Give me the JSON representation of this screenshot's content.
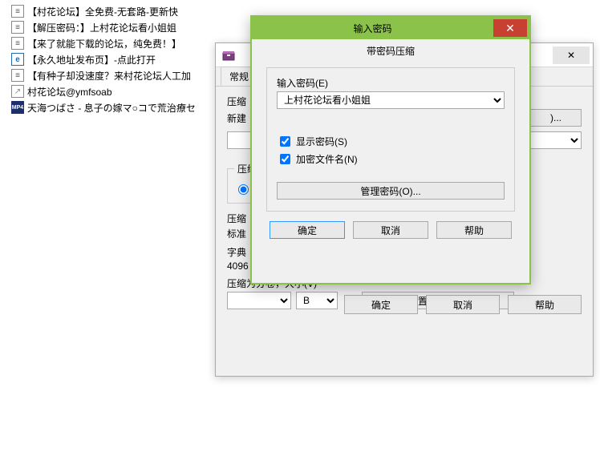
{
  "files": {
    "items": [
      {
        "icon": "text",
        "label": "【村花论坛】全免费-无套路-更新快"
      },
      {
        "icon": "text",
        "label": "【解压密码：】上村花论坛看小姐姐"
      },
      {
        "icon": "text",
        "label": "【来了就能下载的论坛，纯免费！】"
      },
      {
        "icon": "ie",
        "label": "【永久地址发布页】-点此打开"
      },
      {
        "icon": "text",
        "label": "【有种子却没速度？来村花论坛人工加"
      },
      {
        "icon": "url",
        "label": "村花论坛@ymfsoab"
      },
      {
        "icon": "mp4",
        "label": "天海つばさ - 息子の嫁マ○コで荒治療セ"
      }
    ]
  },
  "rar": {
    "tabs": {
      "general": "常规"
    },
    "archive_name_label": "压缩",
    "browse_label": ")...",
    "update_mode_label": "新建",
    "format_legend": "压缩",
    "format_rar": "⦿",
    "method_label": "压缩",
    "method_value": "标准",
    "dict_label": "字典",
    "dict_value": "4096",
    "split_label": "压缩为分卷，大小(V)",
    "split_unit": "B",
    "set_password": "设置密码(P)...",
    "ok": "确定",
    "cancel": "取消",
    "help": "帮助"
  },
  "pwd": {
    "title": "输入密码",
    "subtitle": "带密码压缩",
    "enter_label": "输入密码(E)",
    "value": "上村花论坛看小姐姐",
    "show": "显示密码(S)",
    "encrypt_names": "加密文件名(N)",
    "manage": "管理密码(O)...",
    "ok": "确定",
    "cancel": "取消",
    "help": "帮助",
    "close_glyph": "✕"
  }
}
